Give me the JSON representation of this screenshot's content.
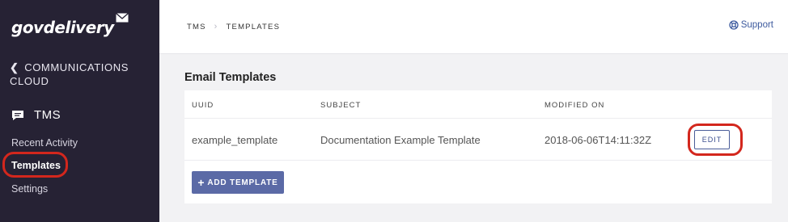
{
  "sidebar": {
    "logo": "govdelivery",
    "back_line1": "COMMUNICATIONS",
    "back_line2": "CLOUD",
    "section": "TMS",
    "items": [
      {
        "label": "Recent Activity",
        "active": false
      },
      {
        "label": "Templates",
        "active": true
      },
      {
        "label": "Settings",
        "active": false
      }
    ]
  },
  "header": {
    "breadcrumb": [
      "TMS",
      "TEMPLATES"
    ],
    "support_label": "Support"
  },
  "main": {
    "title": "Email Templates",
    "columns": [
      "UUID",
      "SUBJECT",
      "MODIFIED ON"
    ],
    "rows": [
      {
        "uuid": "example_template",
        "subject": "Documentation Example Template",
        "modified_on": "2018-06-06T14:11:32Z",
        "action": "EDIT"
      }
    ],
    "add_button": "ADD TEMPLATE"
  },
  "colors": {
    "sidebar_bg": "#262234",
    "accent": "#5b6aa6",
    "highlight": "#d3271d"
  }
}
